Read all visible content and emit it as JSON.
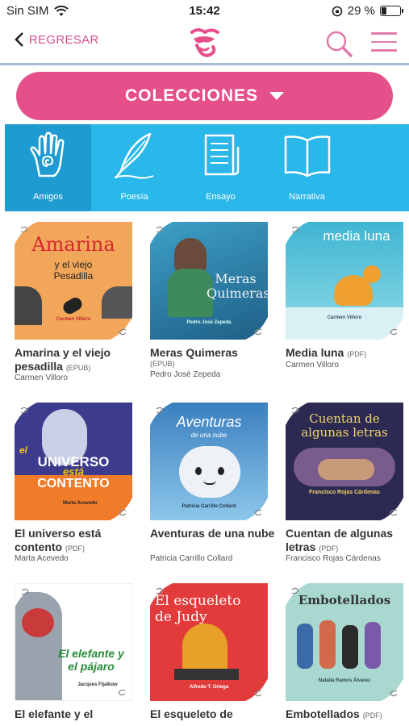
{
  "status_bar": {
    "carrier": "Sin SIM",
    "time": "15:42",
    "battery": "29 %",
    "battery_level": 0.29
  },
  "nav": {
    "back_label": "REGRESAR"
  },
  "collections": {
    "label": "COLECCIONES"
  },
  "categories": [
    {
      "label": "Amigos",
      "icon": "hand-icon"
    },
    {
      "label": "Poesía",
      "icon": "quill-icon"
    },
    {
      "label": "Ensayo",
      "icon": "scroll-icon"
    },
    {
      "label": "Narrativa",
      "icon": "open-book-icon"
    }
  ],
  "books": [
    {
      "title": "Amarina y el viejo pesadilla",
      "format": "(EPUB)",
      "author": "Carmen Villoro",
      "cover_title": "Amarina",
      "cover_sub": "y el viejo Pesadilla",
      "cover_author": "Carmen Villoro",
      "cover_color": "#f2a65a"
    },
    {
      "title": "Meras Quimeras",
      "format": "(EPUB)",
      "author": "Pedro José Zepeda",
      "cover_title": "Meras Quimeras",
      "cover_author": "Pedro José Zepeda",
      "cover_color": "#2f86b0"
    },
    {
      "title": "Media luna",
      "format": "(PDF)",
      "author": "Carmen Villoro",
      "cover_title": "media luna",
      "cover_author": "Carmen Villoro",
      "cover_color": "#5fc3d8"
    },
    {
      "title": "El universo está contento",
      "format": "(PDF)",
      "author": "Marta Acevedo",
      "cover_title": "UNIVERSO",
      "cover_pre": "el",
      "cover_mid": "está",
      "cover_sub": "CONTENTO",
      "cover_author": "Marta Acevedo",
      "cover_color": "#3d3b8e"
    },
    {
      "title": "Aventuras de una nube",
      "format": "(PDF)",
      "author": "Patricia Carrillo Collard",
      "cover_title": "Aventuras",
      "cover_sub": "de una nube",
      "cover_author": "Patricia Carrillo Collard",
      "cover_color": "#4a8fc4"
    },
    {
      "title": "Cuentan de algunas letras",
      "format": "(PDF)",
      "author": "Francisco Rojas Cárdenas",
      "cover_title": "Cuentan de algunas letras",
      "cover_author": "Francisco Rojas Cárdenas",
      "cover_color": "#2c2a52"
    },
    {
      "title": "El elefante y el",
      "format": "",
      "author": "",
      "cover_title": "El elefante y el pájaro",
      "cover_author": "Jacques Fijalkow",
      "cover_color": "#ffffff"
    },
    {
      "title": "El esqueleto de",
      "format": "",
      "author": "",
      "cover_title": "El esqueleto de Judy",
      "cover_author": "Alfredo T. Ortega",
      "cover_color": "#e23b3b"
    },
    {
      "title": "Embotellados",
      "format": "(PDF)",
      "author": "",
      "cover_title": "Embotellados",
      "cover_author": "Natalia Ramos Álvarez",
      "cover_color": "#a8d8cf"
    }
  ],
  "colors": {
    "accent_pink": "#e6508a",
    "category_blue": "#2ab7ea",
    "category_active": "#1e9bd0"
  }
}
